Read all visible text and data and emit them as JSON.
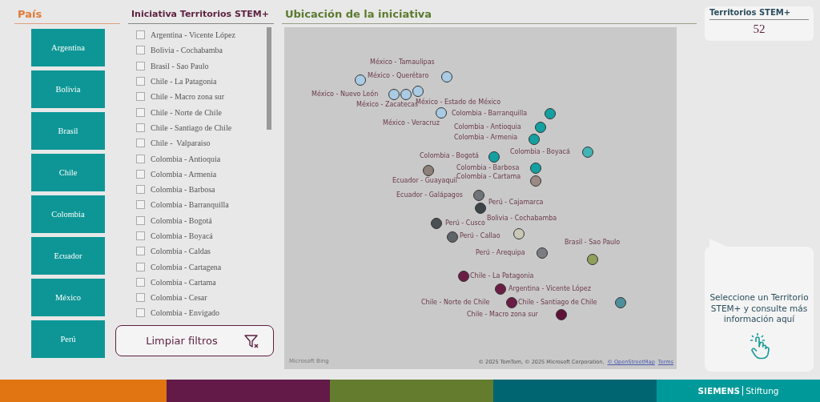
{
  "country_slicer": {
    "title": "País",
    "buttons": [
      {
        "label": "Argentina",
        "selected": false
      },
      {
        "label": "Bolivia",
        "selected": false
      },
      {
        "label": "Brasil",
        "selected": false
      },
      {
        "label": "Chile",
        "selected": false
      },
      {
        "label": "Colombia",
        "selected": false
      },
      {
        "label": "Ecuador",
        "selected": false
      },
      {
        "label": "México",
        "selected": false
      },
      {
        "label": "Perú",
        "selected": false
      }
    ]
  },
  "initiative_slicer": {
    "title": "Iniciativa Territorios STEM+",
    "items": [
      {
        "label": "Argentina - Vicente López",
        "checked": false
      },
      {
        "label": "Bolivia - Cochabamba",
        "checked": false
      },
      {
        "label": "Brasil - Sao Paulo",
        "checked": false
      },
      {
        "label": "Chile - La Patagonia",
        "checked": false
      },
      {
        "label": "Chile - Macro zona sur",
        "checked": false
      },
      {
        "label": "Chile - Norte de Chile",
        "checked": false
      },
      {
        "label": "Chile - Santiago de Chile",
        "checked": false
      },
      {
        "label": "Chile -  Valparaiso",
        "checked": false
      },
      {
        "label": "Colombia - Antioquia",
        "checked": false
      },
      {
        "label": "Colombia - Armenia",
        "checked": false
      },
      {
        "label": "Colombia - Barbosa",
        "checked": false
      },
      {
        "label": "Colombia - Barranquilla",
        "checked": false
      },
      {
        "label": "Colombia - Bogotá",
        "checked": false
      },
      {
        "label": "Colombia - Boyacá",
        "checked": false
      },
      {
        "label": "Colombia - Caldas",
        "checked": false
      },
      {
        "label": "Colombia - Cartagena",
        "checked": false
      },
      {
        "label": "Colombia - Cartama",
        "checked": false
      },
      {
        "label": "Colombia - Cesar",
        "checked": false
      },
      {
        "label": "Colombia - Envigado",
        "checked": false
      }
    ],
    "clear_button": "Limpiar filtros"
  },
  "map": {
    "title": "Ubicación de la iniciativa",
    "markers": [
      {
        "label": "México - Tamaulipas",
        "color": "#a9cbe3"
      },
      {
        "label": "México - Querétaro",
        "color": "#a9cbe3"
      },
      {
        "label": "México - Nuevo León",
        "color": "#a9cbe3"
      },
      {
        "label": "México - Zacatecas",
        "color": "#a9cbe3"
      },
      {
        "label": "México - Estado de México",
        "color": "#a9cbe3"
      },
      {
        "label": "México - Veracruz",
        "color": "#a9cbe3"
      },
      {
        "label": "Colombia - Barranquilla",
        "color": "#14a0a0"
      },
      {
        "label": "Colombia - Antioquia",
        "color": "#14a0a0"
      },
      {
        "label": "Colombia - Armenia",
        "color": "#14a0a0"
      },
      {
        "label": "Colombia - Boyacá",
        "color": "#44b3b5"
      },
      {
        "label": "Colombia - Bogotá",
        "color": "#14a0a0"
      },
      {
        "label": "Colombia - Barbosa",
        "color": "#14a0a0"
      },
      {
        "label": "Colombia - Cartama",
        "color": "#9b8a84"
      },
      {
        "label": "Ecuador - Guayaquil",
        "color": "#8d7f79"
      },
      {
        "label": "Ecuador - Galápagos",
        "color": "#6f7479"
      },
      {
        "label": "Perú - Cajamarca",
        "color": "#3d4447"
      },
      {
        "label": "Bolivia - Cochabamba",
        "color": "#c9c7b5"
      },
      {
        "label": "Perú - Cusco",
        "color": "#4a5054"
      },
      {
        "label": "Perú - Callao",
        "color": "#5f6468"
      },
      {
        "label": "Brasil - Sao Paulo",
        "color": "#8fa05a"
      },
      {
        "label": "Perú - Arequipa",
        "color": "#7a7e82"
      },
      {
        "label": "Chile - La Patagonia",
        "color": "#6b1e45"
      },
      {
        "label": "Argentina - Vicente López",
        "color": "#6b1e45"
      },
      {
        "label": "Chile - Norte de Chile",
        "color": "#6b1e45"
      },
      {
        "label": "Chile - Santiago de Chile",
        "color": "#4f8f9c"
      },
      {
        "label": "Chile - Macro zona sur",
        "color": "#5e1238"
      }
    ],
    "provider": "Microsoft Bing",
    "attribution": "© 2025 TomTom, © 2025 Microsoft Corporation,",
    "attribution_links": [
      "© OpenStreetMap",
      "Terms"
    ]
  },
  "kpi_card": {
    "title": "Territorios STEM+",
    "value": "52"
  },
  "info_card": {
    "text": "Seleccione un Territorio STEM+ y consulte más información aquí"
  },
  "footer": {
    "brand": "SIEMENS",
    "brand_suffix": "Stiftung"
  }
}
